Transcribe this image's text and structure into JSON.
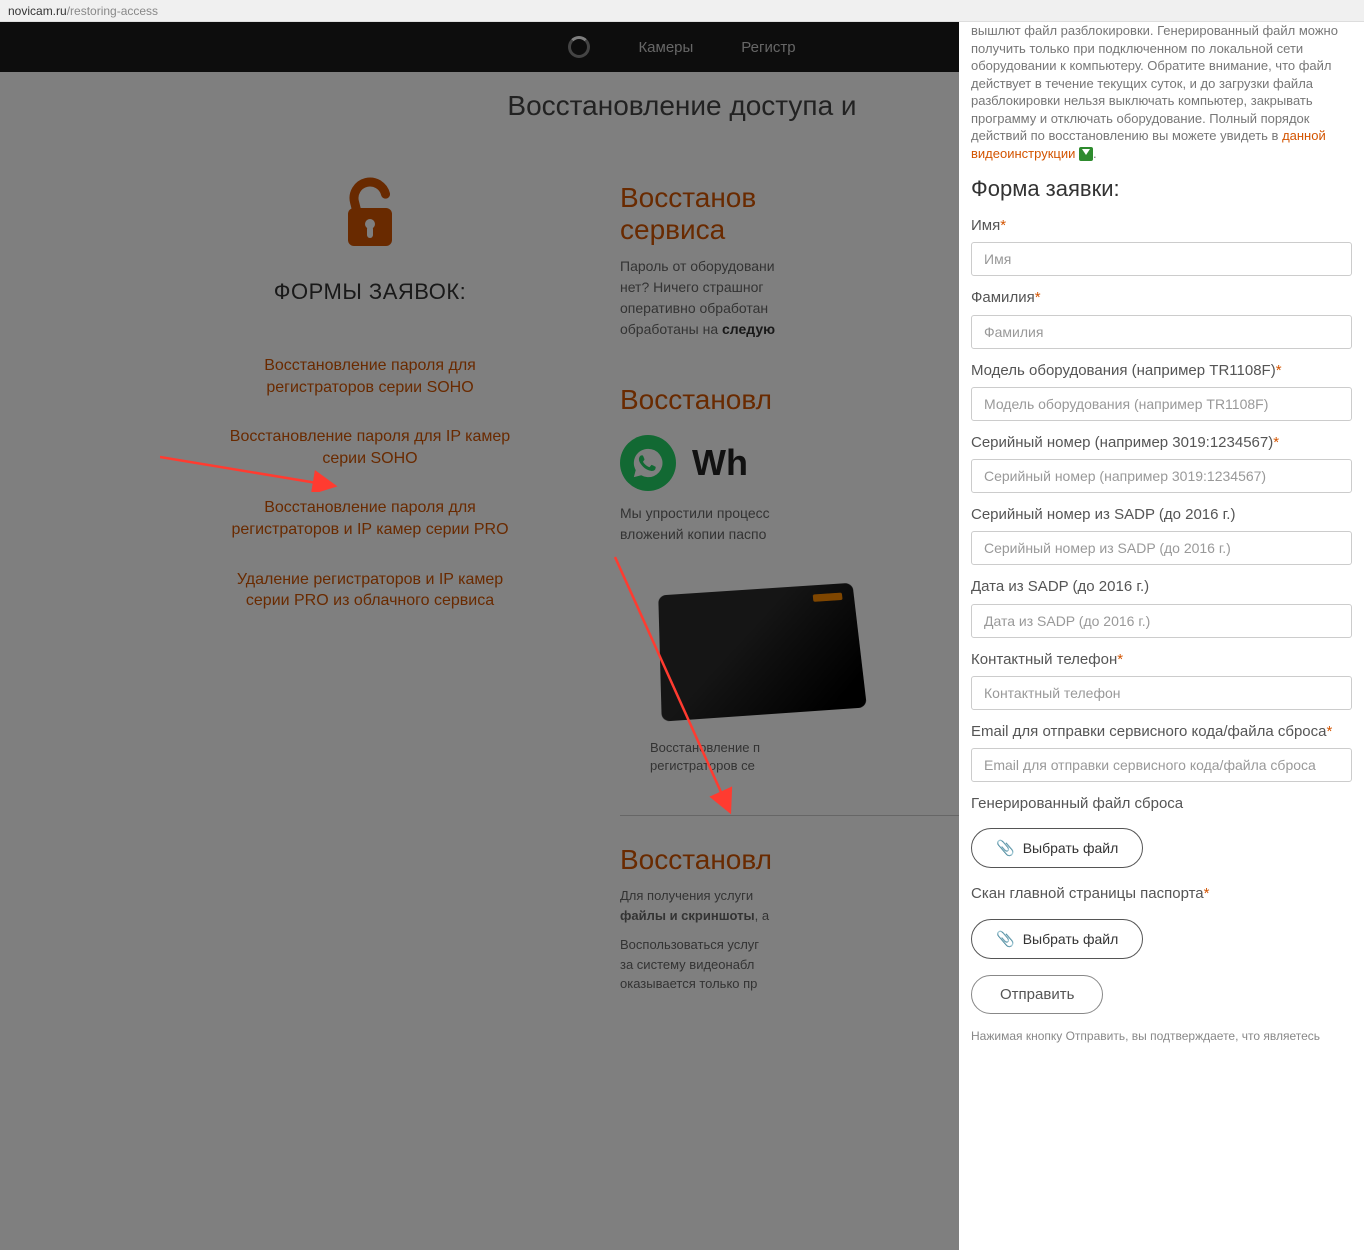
{
  "url": {
    "domain": "novicam.ru",
    "path": "/restoring-access"
  },
  "nav": {
    "cameras": "Камеры",
    "registr": "Регистр"
  },
  "page_title": "Восстановление доступа и",
  "left": {
    "forms_title": "ФОРМЫ ЗАЯВОК:",
    "links": [
      "Восстановление пароля для регистраторов серии SOHO",
      "Восстановление пароля для IP камер серии SOHO",
      "Восстановление пароля для регистраторов и IP камер серии PRO",
      "Удаление регистраторов и IP камер серии PRO из облачного сервиса"
    ]
  },
  "right": {
    "sec1_h": "Восстанов\nсервиса",
    "sec1_p1a": "Пароль от оборудовани",
    "sec1_p1b": "нет? Ничего страшног",
    "sec1_p1c": "оперативно обработан",
    "sec1_p1d_prefix": "обработаны на ",
    "sec1_p1d_bold": "следую",
    "sec2_h": "Восстановл",
    "wa_text": "Wh",
    "sec2_p1": "Мы упростили процесс",
    "sec2_p2": "вложений копии паспо",
    "caption1": "Восстановление п",
    "caption2": "регистраторов се",
    "sec3_h": "Восстановл",
    "sec3_p1": "Для получения услуги ",
    "sec3_bold": "файлы и скриншоты",
    "sec3_p1_tail": ", а",
    "sec3_p2": "Воспользоваться услуг",
    "sec3_p3": "за систему видеонабл",
    "sec3_p4": "оказывается только пр"
  },
  "panel": {
    "intro1": "вышлют файл разблокировки. Генерированный файл можно получить только при подключенном по локальной сети оборудовании к компьютеру.  Обратите внимание, что файл действует в течение текущих суток, и до загрузки файла разблокировки нельзя выключать компьютер, закрывать программу и отключать оборудование. Полный порядок действий по восстановлению вы можете увидеть в ",
    "intro_link": "данной видеоинструкции",
    "form_title": "Форма заявки:",
    "fields": {
      "name_label": "Имя",
      "name_ph": "Имя",
      "surname_label": "Фамилия",
      "surname_ph": "Фамилия",
      "model_label": "Модель оборудования (например TR1108F)",
      "model_ph": "Модель оборудования (например TR1108F)",
      "serial_label": "Серийный номер (например 3019:1234567)",
      "serial_ph": "Серийный номер (например 3019:1234567)",
      "sadp_serial_label": "Серийный номер из SADP (до 2016 г.)",
      "sadp_serial_ph": "Серийный номер из SADP (до 2016 г.)",
      "sadp_date_label": "Дата из SADP (до 2016 г.)",
      "sadp_date_ph": "Дата из SADP (до 2016 г.)",
      "phone_label": "Контактный телефон",
      "phone_ph": "Контактный телефон",
      "email_label": "Email для отправки сервисного кода/файла сброса",
      "email_ph": "Email для отправки сервисного кода/файла сброса",
      "gen_file_label": "Генерированный файл сброса",
      "choose_file": "Выбрать файл",
      "passport_label": "Скан главной страницы паспорта",
      "submit": "Отправить",
      "disclaimer": "Нажимая кнопку Отправить, вы подтверждаете, что являетесь"
    },
    "required_star": "*"
  }
}
